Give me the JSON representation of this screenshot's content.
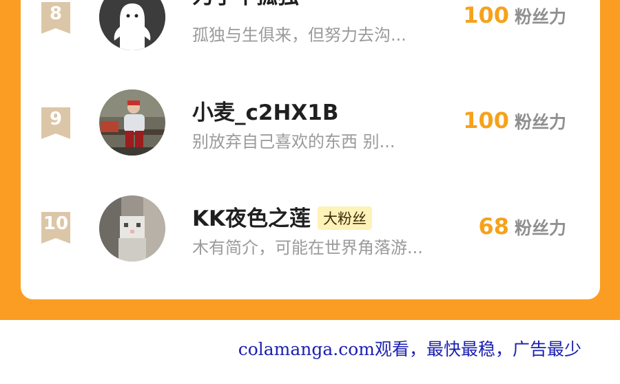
{
  "colors": {
    "accent": "#fb9d23",
    "score": "#f5a21b",
    "badge_bg": "#fdf2b8",
    "rank_badge": "#dcc6a8"
  },
  "leaderboard": [
    {
      "rank": "8",
      "name": "为了不孤独",
      "badge": "",
      "bio": "孤独与生俱来，但努力去沟...",
      "score": "100",
      "unit": "粉丝力",
      "avatar_icon": "ghost-avatar"
    },
    {
      "rank": "9",
      "name": "小麦_c2HX1B",
      "badge": "",
      "bio": "别放弃自己喜欢的东西 别...",
      "score": "100",
      "unit": "粉丝力",
      "avatar_icon": "photo-avatar"
    },
    {
      "rank": "10",
      "name": "KK夜色之莲",
      "badge": "大粉丝",
      "bio": "木有简介，可能在世界角落游...",
      "score": "68",
      "unit": "粉丝力",
      "avatar_icon": "cat-avatar"
    }
  ],
  "watermark": "colamanga.com观看，最快最稳，广告最少"
}
